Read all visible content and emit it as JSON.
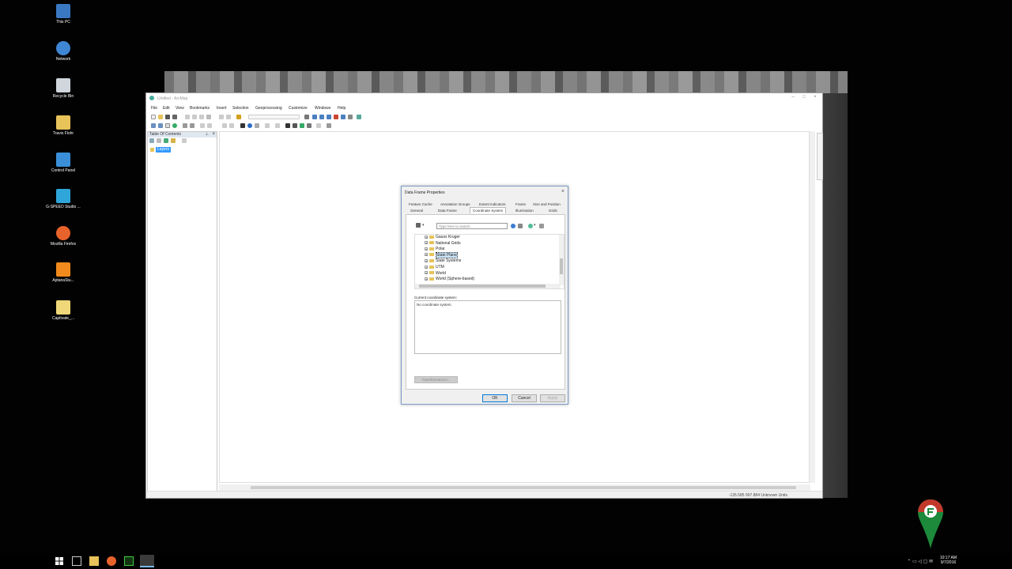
{
  "desktop": {
    "icons": [
      {
        "label": "This PC",
        "icon": "computer-icon",
        "color": "#3a78c2"
      },
      {
        "label": "Network",
        "icon": "network-icon",
        "color": "#3f86d4"
      },
      {
        "label": "Recycle Bin",
        "icon": "recycle-bin-icon",
        "color": "#d0d6dc"
      },
      {
        "label": "Travis Flohr",
        "icon": "user-folder-icon",
        "color": "#e8c35a"
      },
      {
        "label": "Control Panel",
        "icon": "control-panel-icon",
        "color": "#3a8fd8"
      },
      {
        "label": "G-SPEED Studio ...",
        "icon": "gspeed-icon",
        "color": "#2fa6d9"
      },
      {
        "label": "Mozilla Firefox",
        "icon": "firefox-icon",
        "color": "#e8632b"
      },
      {
        "label": "AptanaStu...",
        "icon": "aptana-icon",
        "color": "#f08a1c"
      },
      {
        "label": "Captivate_...",
        "icon": "file-icon",
        "color": "#f0d87a"
      }
    ]
  },
  "app": {
    "title": "Untitled - ArcMap",
    "menu": [
      "File",
      "Edit",
      "View",
      "Bookmarks",
      "Insert",
      "Selection",
      "Geoprocessing",
      "Customize",
      "Windows",
      "Help"
    ],
    "toc_title": "Table Of Contents",
    "layers_label": "Layers",
    "status_coords": "-135.585  997.884 Unknown Units"
  },
  "dialog": {
    "title": "Data Frame Properties",
    "tabs_row1": [
      "Feature Cache",
      "Annotation Groups",
      "Extent Indicators",
      "Frame",
      "Size and Position"
    ],
    "tabs_row2": [
      "General",
      "Data Frame",
      "Coordinate System",
      "Illumination",
      "Grids"
    ],
    "search_placeholder": "Type here to search",
    "tree_items": [
      {
        "label": "Gauss Kruger",
        "selected": false
      },
      {
        "label": "National Grids",
        "selected": false
      },
      {
        "label": "Polar",
        "selected": false
      },
      {
        "label": "State Plane",
        "selected": true
      },
      {
        "label": "State Systems",
        "selected": false
      },
      {
        "label": "UTM",
        "selected": false
      },
      {
        "label": "World",
        "selected": false
      },
      {
        "label": "World (Sphere-based)",
        "selected": false
      }
    ],
    "current_label": "Current coordinate system:",
    "current_value": "No coordinate system.",
    "transformations_label": "Transformations...",
    "ok_label": "OK",
    "cancel_label": "Cancel",
    "apply_label": "Apply"
  },
  "taskbar": {
    "time": "10:17 AM",
    "date": "9/7/2016"
  }
}
